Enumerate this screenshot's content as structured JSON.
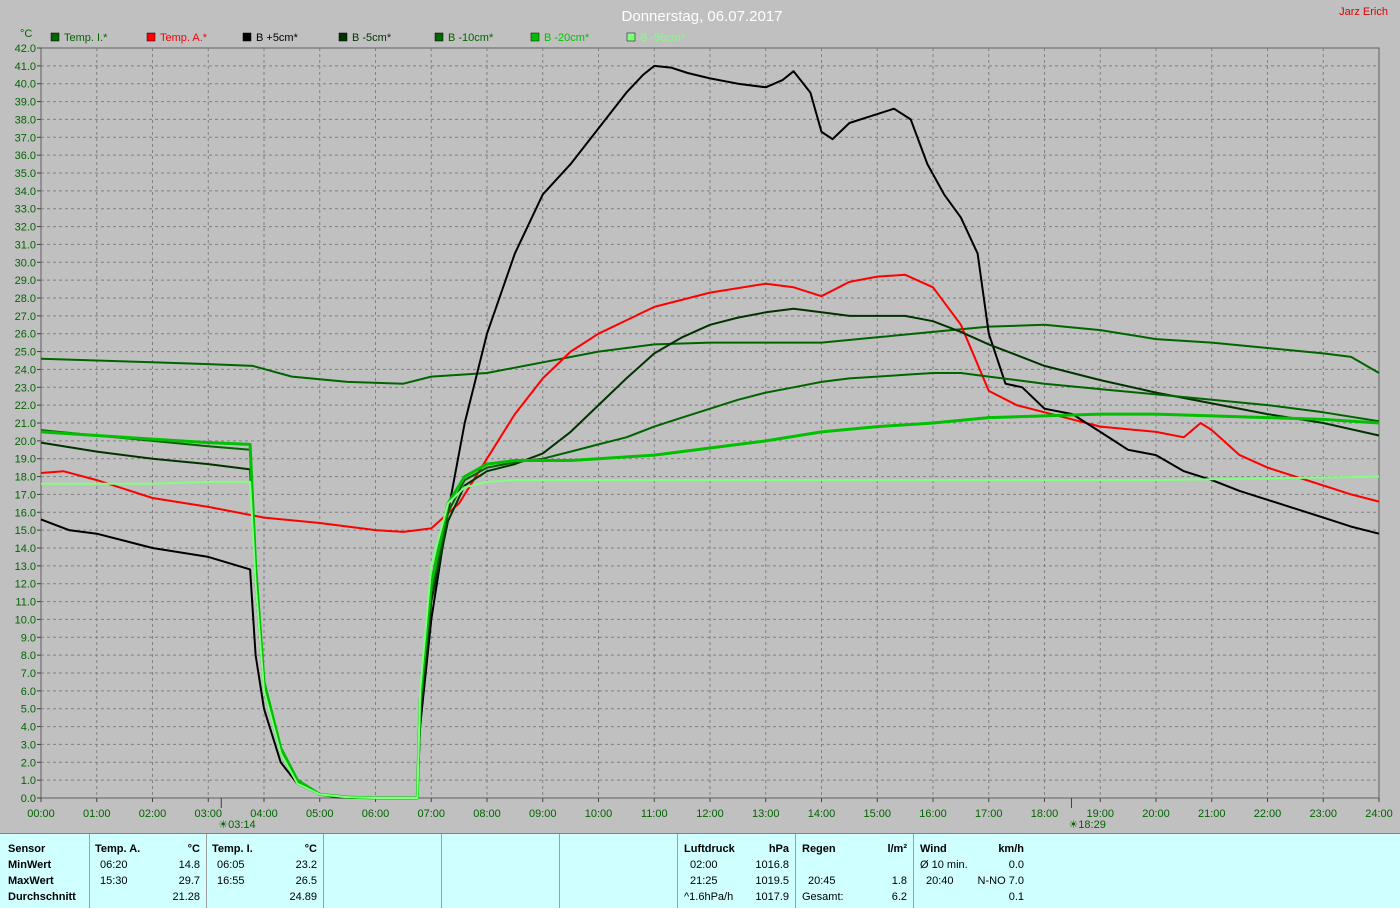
{
  "title": "Donnerstag, 06.07.2017",
  "author": "Jarz Erich",
  "chart_data": {
    "type": "line",
    "y_unit": "°C",
    "ylim": [
      0,
      42
    ],
    "y_ticks": [
      "0.0",
      "1.0",
      "2.0",
      "3.0",
      "4.0",
      "5.0",
      "6.0",
      "7.0",
      "8.0",
      "9.0",
      "10.0",
      "11.0",
      "12.0",
      "13.0",
      "14.0",
      "15.0",
      "16.0",
      "17.0",
      "18.0",
      "19.0",
      "20.0",
      "21.0",
      "22.0",
      "23.0",
      "24.0",
      "25.0",
      "26.0",
      "27.0",
      "28.0",
      "29.0",
      "30.0",
      "31.0",
      "32.0",
      "33.0",
      "34.0",
      "35.0",
      "36.0",
      "37.0",
      "38.0",
      "39.0",
      "40.0",
      "41.0",
      "42.0"
    ],
    "x_ticks": [
      "00:00",
      "01:00",
      "02:00",
      "03:00",
      "04:00",
      "05:00",
      "06:00",
      "07:00",
      "08:00",
      "09:00",
      "10:00",
      "11:00",
      "12:00",
      "13:00",
      "14:00",
      "15:00",
      "16:00",
      "17:00",
      "18:00",
      "19:00",
      "20:00",
      "21:00",
      "22:00",
      "23:00",
      "24:00"
    ],
    "xlim": [
      0,
      24
    ],
    "grid": true,
    "legend_position": "top",
    "sunrise": "03:14",
    "sunset": "18:29",
    "series": [
      {
        "name": "Temp. I.*",
        "color": "#006400",
        "x": [
          0,
          1,
          2,
          3,
          3.8,
          4.5,
          5.5,
          6.5,
          7,
          8,
          9,
          10,
          11,
          12,
          13,
          14,
          15,
          16,
          17,
          18,
          19,
          20,
          21,
          22,
          23,
          23.5,
          24
        ],
        "y": [
          24.6,
          24.5,
          24.4,
          24.3,
          24.2,
          23.6,
          23.3,
          23.2,
          23.6,
          23.8,
          24.4,
          25.0,
          25.4,
          25.5,
          25.5,
          25.5,
          25.8,
          26.1,
          26.4,
          26.5,
          26.2,
          25.7,
          25.5,
          25.2,
          24.9,
          24.7,
          23.8
        ]
      },
      {
        "name": "Temp. A.*",
        "color": "#ff0000",
        "x": [
          0,
          0.4,
          1,
          2,
          3,
          4,
          5,
          6,
          6.5,
          7,
          7.5,
          8,
          8.5,
          9,
          9.5,
          10,
          11,
          12,
          13,
          13.5,
          14,
          14.5,
          15,
          15.5,
          16,
          16.5,
          17,
          17.5,
          18,
          19,
          20,
          20.5,
          20.8,
          21,
          21.5,
          22,
          22.5,
          23,
          23.5,
          24
        ],
        "y": [
          18.2,
          18.3,
          17.8,
          16.8,
          16.3,
          15.7,
          15.4,
          15.0,
          14.9,
          15.1,
          16.5,
          19.0,
          21.5,
          23.5,
          25.0,
          26.0,
          27.5,
          28.3,
          28.8,
          28.6,
          28.1,
          28.9,
          29.2,
          29.3,
          28.6,
          26.5,
          22.8,
          22.0,
          21.6,
          20.8,
          20.5,
          20.2,
          21.0,
          20.6,
          19.2,
          18.5,
          18.0,
          17.5,
          17.0,
          16.6
        ]
      },
      {
        "name": "B +5cm*",
        "color": "#000000",
        "x": [
          0,
          0.5,
          1,
          2,
          3,
          3.75,
          3.85,
          4,
          4.3,
          4.6,
          5,
          5.3,
          5.6,
          6,
          6.5,
          6.75,
          6.8,
          7,
          7.3,
          7.6,
          8,
          8.5,
          9,
          9.5,
          10,
          10.5,
          10.8,
          11,
          11.3,
          11.6,
          12,
          12.5,
          13,
          13.3,
          13.5,
          13.8,
          14,
          14.2,
          14.5,
          15,
          15.3,
          15.6,
          15.9,
          16.2,
          16.5,
          16.8,
          17,
          17.3,
          17.6,
          18,
          18.5,
          19,
          19.5,
          20,
          20.5,
          21,
          21.5,
          22,
          22.5,
          23,
          23.5,
          24
        ],
        "y": [
          15.6,
          15.0,
          14.8,
          14.0,
          13.5,
          12.8,
          8.0,
          5.0,
          2.0,
          0.8,
          0.2,
          0.05,
          0.0,
          0.0,
          0.0,
          0.0,
          4.0,
          10.0,
          16.0,
          21.0,
          26.0,
          30.5,
          33.8,
          35.5,
          37.5,
          39.5,
          40.5,
          41.0,
          40.9,
          40.6,
          40.3,
          40.0,
          39.8,
          40.2,
          40.7,
          39.5,
          37.3,
          36.9,
          37.8,
          38.3,
          38.6,
          38.0,
          35.5,
          33.8,
          32.5,
          30.5,
          26.0,
          23.2,
          23.0,
          21.8,
          21.5,
          20.5,
          19.5,
          19.2,
          18.3,
          17.8,
          17.2,
          16.7,
          16.2,
          15.7,
          15.2,
          14.8
        ]
      },
      {
        "name": "B -5cm*",
        "color": "#003300",
        "x": [
          0,
          1,
          2,
          3,
          3.75,
          3.85,
          4,
          4.3,
          4.6,
          5,
          5.5,
          6,
          6.75,
          6.8,
          7,
          7.3,
          7.6,
          8,
          8.5,
          9,
          9.5,
          10,
          10.5,
          11,
          11.5,
          12,
          12.5,
          13,
          13.5,
          14,
          14.5,
          15,
          15.5,
          16,
          16.5,
          17,
          17.5,
          18,
          19,
          20,
          21,
          22,
          23,
          24
        ],
        "y": [
          19.9,
          19.4,
          19.0,
          18.7,
          18.4,
          12.0,
          6.0,
          2.5,
          0.8,
          0.2,
          0.05,
          0.0,
          0.0,
          4.5,
          11.0,
          15.5,
          17.5,
          18.3,
          18.7,
          19.3,
          20.5,
          22.0,
          23.5,
          24.9,
          25.8,
          26.5,
          26.9,
          27.2,
          27.4,
          27.2,
          27.0,
          27.0,
          27.0,
          26.7,
          26.1,
          25.4,
          24.8,
          24.2,
          23.4,
          22.7,
          22.1,
          21.5,
          21.0,
          20.3
        ]
      },
      {
        "name": "B -10cm*",
        "color": "#006400",
        "x": [
          0,
          1,
          2,
          3,
          3.75,
          3.85,
          4,
          4.3,
          4.6,
          5,
          5.5,
          6,
          6.75,
          6.8,
          7,
          7.3,
          7.6,
          8,
          8.5,
          9,
          9.5,
          10,
          10.5,
          11,
          11.5,
          12,
          12.5,
          13,
          13.5,
          14,
          14.5,
          15,
          15.5,
          16,
          16.5,
          17,
          17.5,
          18,
          19,
          20,
          21,
          22,
          23,
          24
        ],
        "y": [
          20.6,
          20.3,
          20.0,
          19.7,
          19.5,
          12.5,
          6.2,
          2.6,
          0.9,
          0.2,
          0.05,
          0.0,
          0.0,
          5.0,
          11.5,
          16.0,
          17.8,
          18.5,
          18.8,
          19.0,
          19.4,
          19.8,
          20.2,
          20.8,
          21.3,
          21.8,
          22.3,
          22.7,
          23.0,
          23.3,
          23.5,
          23.6,
          23.7,
          23.8,
          23.8,
          23.6,
          23.4,
          23.2,
          22.9,
          22.6,
          22.3,
          22.0,
          21.6,
          21.1
        ]
      },
      {
        "name": "B -20cm*",
        "color": "#00c000",
        "x": [
          0,
          1,
          2,
          3,
          3.75,
          3.85,
          4,
          4.3,
          4.6,
          5,
          5.5,
          6,
          6.75,
          6.8,
          7,
          7.3,
          7.6,
          8,
          8.5,
          9,
          9.5,
          10,
          11,
          12,
          13,
          14,
          15,
          16,
          17,
          18,
          19,
          20,
          21,
          22,
          23,
          24
        ],
        "y": [
          20.5,
          20.3,
          20.1,
          19.9,
          19.8,
          13.0,
          6.5,
          2.8,
          1.0,
          0.2,
          0.05,
          0.0,
          0.0,
          5.5,
          12.0,
          16.5,
          18.0,
          18.7,
          18.9,
          18.9,
          18.9,
          19.0,
          19.2,
          19.6,
          20.0,
          20.5,
          20.8,
          21.0,
          21.3,
          21.4,
          21.5,
          21.5,
          21.4,
          21.3,
          21.2,
          21.0
        ]
      },
      {
        "name": "B -50cm*",
        "color": "#80ff80",
        "x": [
          0,
          1,
          2,
          3,
          3.75,
          3.85,
          4,
          4.3,
          4.6,
          5,
          5.5,
          6,
          6.75,
          6.8,
          7,
          7.3,
          7.6,
          8,
          8.5,
          9,
          10,
          12,
          14,
          16,
          18,
          20,
          22,
          24
        ],
        "y": [
          17.6,
          17.6,
          17.6,
          17.7,
          17.7,
          12.0,
          6.0,
          2.5,
          0.8,
          0.2,
          0.05,
          0.0,
          0.0,
          6.0,
          13.0,
          16.5,
          17.4,
          17.7,
          17.8,
          17.8,
          17.8,
          17.8,
          17.8,
          17.8,
          17.8,
          17.8,
          17.9,
          18.0
        ]
      }
    ]
  },
  "stats": {
    "sensor_label": "Sensor",
    "row_labels": [
      "MinWert",
      "MaxWert",
      "Durchschnitt"
    ],
    "temp_a": {
      "header": "Temp. A.",
      "unit": "°C",
      "min_time": "06:20",
      "min": "14.8",
      "max_time": "15:30",
      "max": "29.7",
      "avg": "21.28"
    },
    "temp_i": {
      "header": "Temp. I.",
      "unit": "°C",
      "min_time": "06:05",
      "min": "23.2",
      "max_time": "16:55",
      "max": "26.5",
      "avg": "24.89"
    },
    "pressure": {
      "header": "Luftdruck",
      "unit": "hPa",
      "min_time": "02:00",
      "min": "1016.8",
      "max_time": "21:25",
      "max": "1019.5",
      "trend": "^1.6hPa/h",
      "trend_val": "1017.9"
    },
    "rain": {
      "header": "Regen",
      "unit": "l/m²",
      "max_time": "20:45",
      "max": "1.8",
      "total_label": "Gesamt:",
      "total": "6.2"
    },
    "wind": {
      "header": "Wind",
      "unit": "km/h",
      "avg_label": "Ø 10 min.",
      "avg": "0.0",
      "max_time": "20:40",
      "max": "N-NO 7.0",
      "last": "0.1"
    }
  }
}
